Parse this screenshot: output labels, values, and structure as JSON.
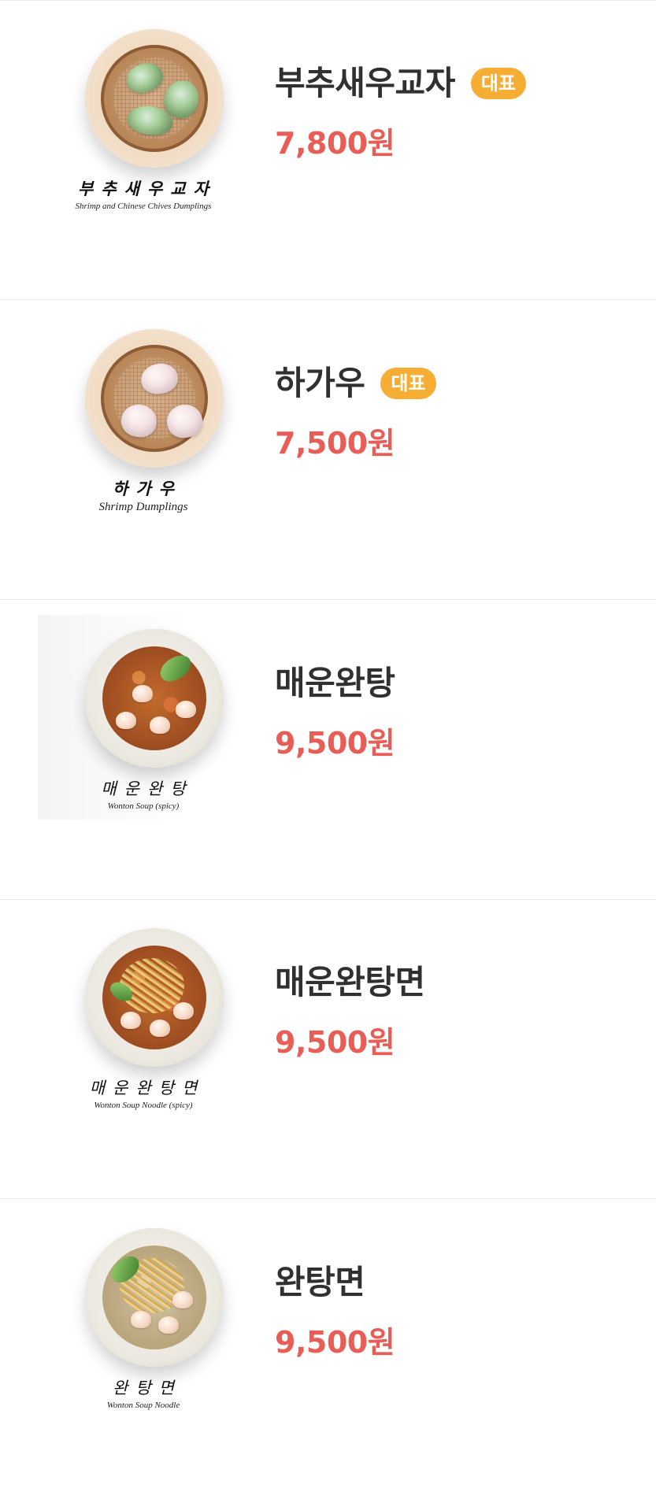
{
  "menu": {
    "items": [
      {
        "name": "부추새우교자",
        "badge": "대표",
        "price": "7,800원",
        "image_caption_ko": "부추새우교자",
        "image_caption_en": "Shrimp and Chinese Chives Dumplings"
      },
      {
        "name": "하가우",
        "badge": "대표",
        "price": "7,500원",
        "image_caption_ko": "하가우",
        "image_caption_en": "Shrimp Dumplings"
      },
      {
        "name": "매운완탕",
        "price": "9,500원",
        "image_caption_ko": "매운완탕",
        "image_caption_en": "Wonton Soup (spicy)"
      },
      {
        "name": "매운완탕면",
        "price": "9,500원",
        "image_caption_ko": "매운완탕면",
        "image_caption_en": "Wonton Soup Noodle (spicy)"
      },
      {
        "name": "완탕면",
        "price": "9,500원",
        "image_caption_ko": "완탕면",
        "image_caption_en": "Wonton Soup Noodle"
      }
    ]
  },
  "colors": {
    "title": "#303030",
    "price": "#e85e56",
    "badge": "#f6ad34",
    "divider": "#e6e6e6"
  }
}
